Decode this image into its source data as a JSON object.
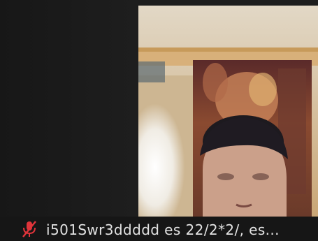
{
  "participant": {
    "name": "i501Swr3ddddd es 22/2*2/, es...",
    "mic_status_icon": "mic-muted-icon",
    "mic_icon_color": "#e0343a"
  },
  "colors": {
    "background": "#1b1b1b",
    "name_text": "#e2e2e2"
  }
}
